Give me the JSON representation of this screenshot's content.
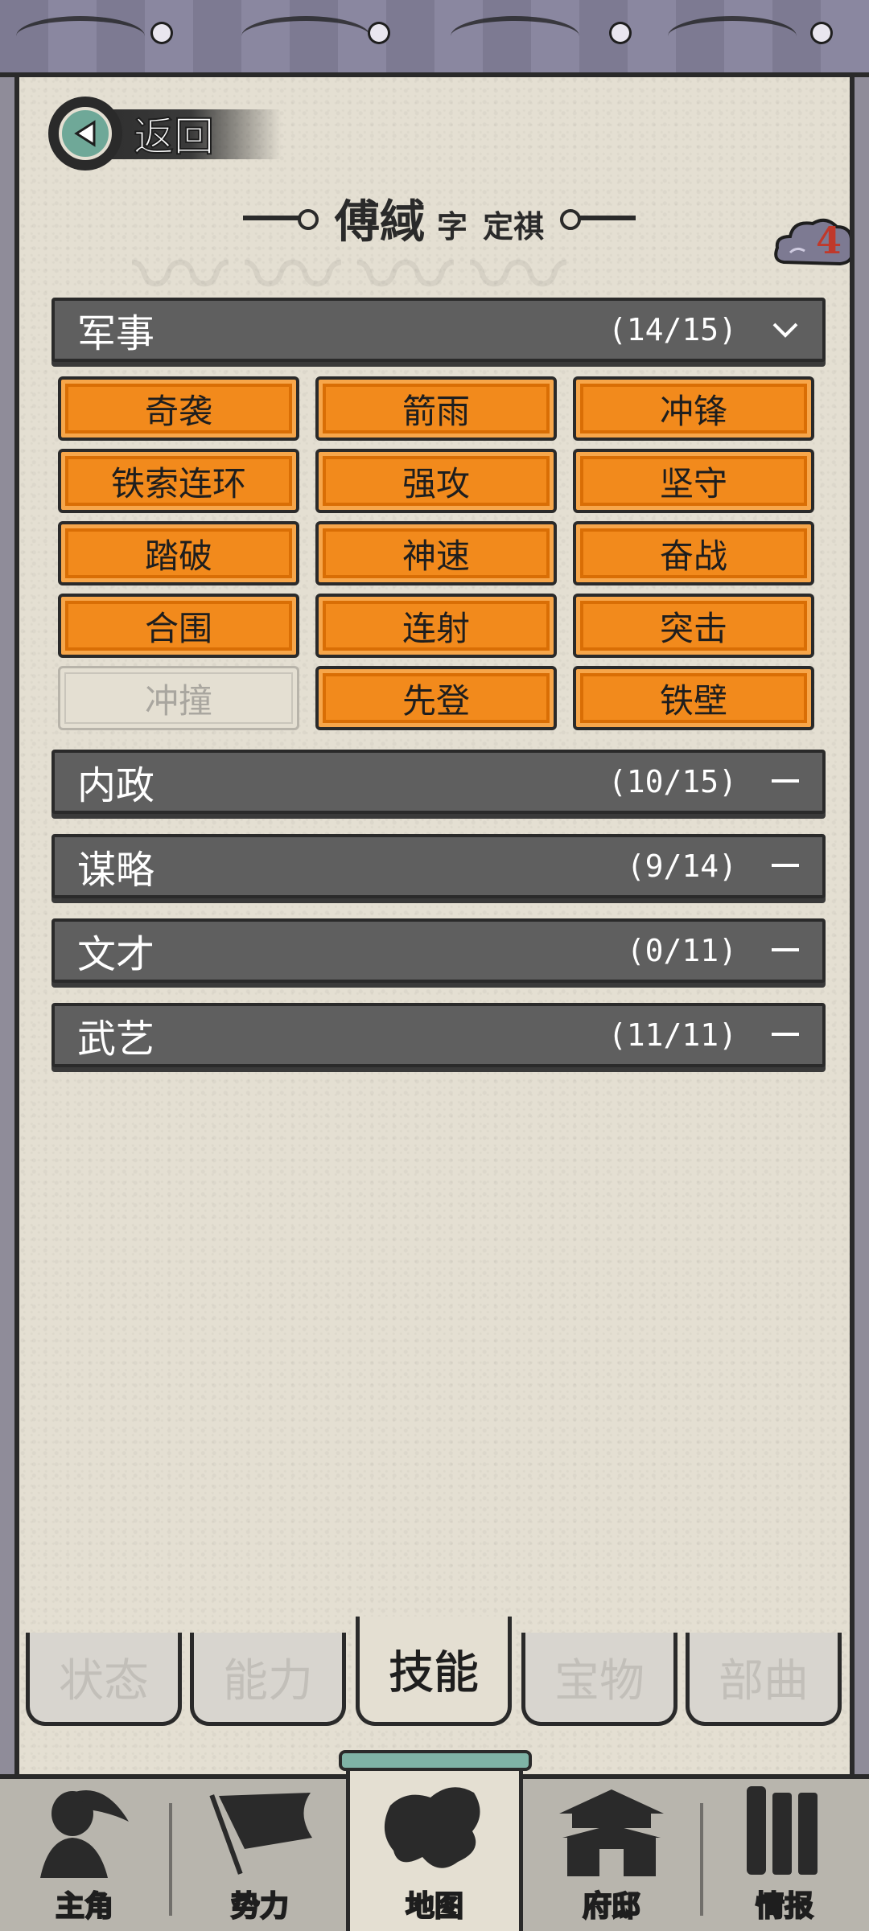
{
  "header": {
    "back_label": "返回",
    "name": "傅緎",
    "zi_label": "字",
    "zi_value": "定祺",
    "badge_count": "4"
  },
  "categories": [
    {
      "label": "军事",
      "count": "(14/15)",
      "expanded": true
    },
    {
      "label": "内政",
      "count": "(10/15)",
      "expanded": false
    },
    {
      "label": "谋略",
      "count": "(9/14)",
      "expanded": false
    },
    {
      "label": "文才",
      "count": "(0/11)",
      "expanded": false
    },
    {
      "label": "武艺",
      "count": "(11/11)",
      "expanded": false
    }
  ],
  "military_skills": [
    {
      "label": "奇袭",
      "learned": true
    },
    {
      "label": "箭雨",
      "learned": true
    },
    {
      "label": "冲锋",
      "learned": true
    },
    {
      "label": "铁索连环",
      "learned": true
    },
    {
      "label": "强攻",
      "learned": true
    },
    {
      "label": "坚守",
      "learned": true
    },
    {
      "label": "踏破",
      "learned": true
    },
    {
      "label": "神速",
      "learned": true
    },
    {
      "label": "奋战",
      "learned": true
    },
    {
      "label": "合围",
      "learned": true
    },
    {
      "label": "连射",
      "learned": true
    },
    {
      "label": "突击",
      "learned": true
    },
    {
      "label": "冲撞",
      "learned": false
    },
    {
      "label": "先登",
      "learned": true
    },
    {
      "label": "铁壁",
      "learned": true
    }
  ],
  "tabs": [
    {
      "label": "状态",
      "active": false
    },
    {
      "label": "能力",
      "active": false
    },
    {
      "label": "技能",
      "active": true
    },
    {
      "label": "宝物",
      "active": false
    },
    {
      "label": "部曲",
      "active": false
    }
  ],
  "bottom_nav": [
    {
      "label": "主角",
      "icon": "warrior-icon",
      "active": false
    },
    {
      "label": "势力",
      "icon": "flag-icon",
      "active": false
    },
    {
      "label": "地图",
      "icon": "map-icon",
      "active": true
    },
    {
      "label": "府邸",
      "icon": "mansion-icon",
      "active": false
    },
    {
      "label": "情报",
      "icon": "scroll-icon",
      "active": false
    }
  ],
  "colors": {
    "skill_learned": "#f28a1c",
    "category_bar": "#5f5f5f",
    "paper": "#e4dfd2",
    "badge_number": "#c0392b"
  }
}
